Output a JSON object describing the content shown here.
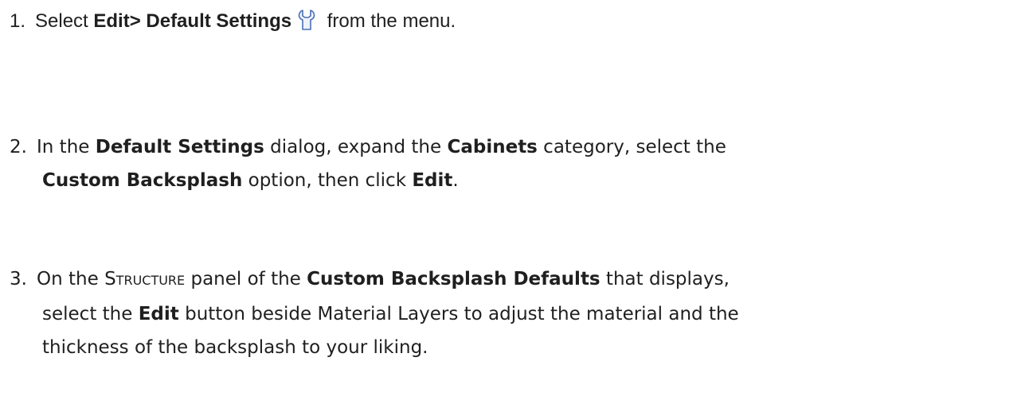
{
  "steps": [
    {
      "number": "1.",
      "prefix": "Select ",
      "menu_path": "Edit> Default Settings",
      "icon": "default-settings-wrench-icon",
      "suffix": " from the menu."
    },
    {
      "number": "2.",
      "t1": "In the ",
      "b1": "Default Settings",
      "t2": " dialog, expand the ",
      "b2": "Cabinets",
      "t3": " category, select the",
      "b3": "Custom Backsplash",
      "t4": " option, then click ",
      "b4": "Edit",
      "t5": "."
    },
    {
      "number": "3.",
      "t1": "On the ",
      "panel_first": "S",
      "panel_rest": "TRUCTURE",
      "t2": " panel of the ",
      "b1": "Custom Backsplash Defaults",
      "t3": " that displays,",
      "t4": "select the ",
      "b2": "Edit",
      "t5": " button beside Material Layers to adjust the material and the",
      "t6": "thickness of the backsplash to your liking."
    }
  ]
}
